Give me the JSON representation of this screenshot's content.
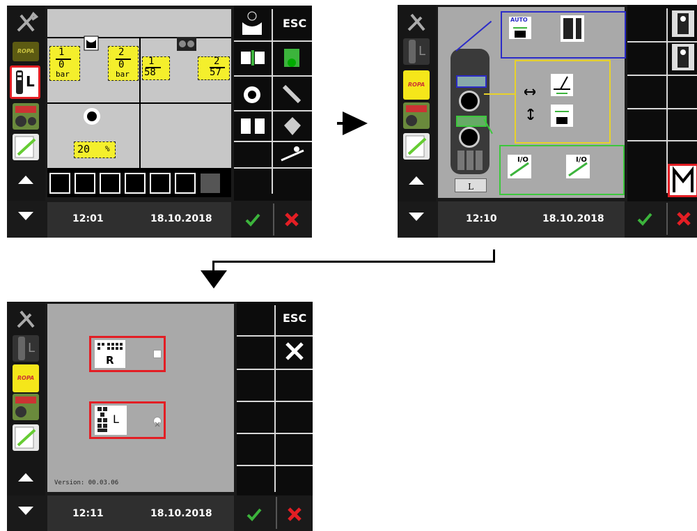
{
  "screen1": {
    "time": "12:01",
    "date": "18.10.2018",
    "esc": "ESC",
    "cells": {
      "p1_top": "1",
      "p1_bottom": "0",
      "p1_unit": "bar",
      "p2_top": "2",
      "p2_bottom": "0",
      "p2_unit": "bar",
      "p3_top": "1",
      "p3_bottom": "58",
      "p4_top": "2",
      "p4_bottom": "57",
      "percent_value": "20",
      "percent_unit": "%"
    }
  },
  "screen2": {
    "time": "12:10",
    "date": "18.10.2018",
    "auto_label": "AUTO",
    "joystick_label": "L",
    "io_label_1": "I/O",
    "io_label_2": "I/O"
  },
  "screen3": {
    "time": "12:11",
    "date": "18.10.2018",
    "esc": "ESC",
    "option_r_label": "R",
    "option_l_label": "L",
    "version": "Version: 00.03.06"
  },
  "left_column": {
    "brand_label": "ROPA",
    "l_label": "L"
  },
  "colors": {
    "confirm": "#3cb43c",
    "cancel": "#e31e24",
    "highlight": "#e31e24",
    "panel_yellow": "#f4ef2c",
    "box_blue": "#2c2cc8",
    "box_yellow": "#e8d22a",
    "box_green": "#3cc83c"
  }
}
